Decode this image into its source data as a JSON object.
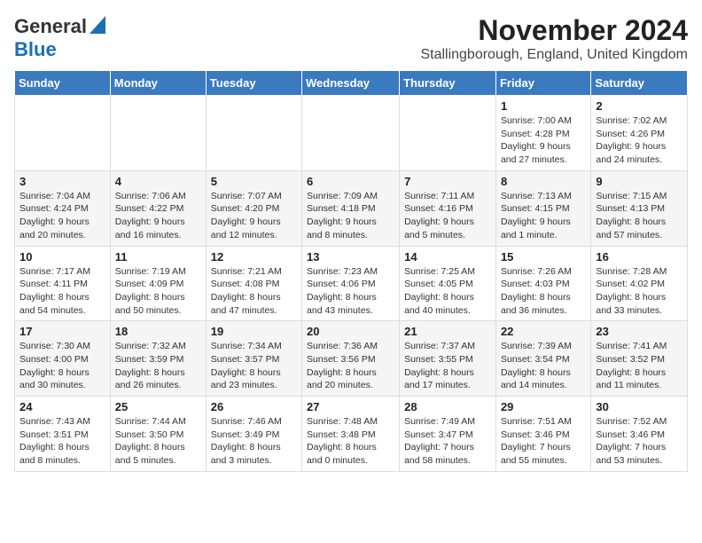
{
  "logo": {
    "line1": "General",
    "line2": "Blue"
  },
  "title": "November 2024",
  "subtitle": "Stallingborough, England, United Kingdom",
  "days_of_week": [
    "Sunday",
    "Monday",
    "Tuesday",
    "Wednesday",
    "Thursday",
    "Friday",
    "Saturday"
  ],
  "weeks": [
    [
      {
        "day": "",
        "info": ""
      },
      {
        "day": "",
        "info": ""
      },
      {
        "day": "",
        "info": ""
      },
      {
        "day": "",
        "info": ""
      },
      {
        "day": "",
        "info": ""
      },
      {
        "day": "1",
        "info": "Sunrise: 7:00 AM\nSunset: 4:28 PM\nDaylight: 9 hours and 27 minutes."
      },
      {
        "day": "2",
        "info": "Sunrise: 7:02 AM\nSunset: 4:26 PM\nDaylight: 9 hours and 24 minutes."
      }
    ],
    [
      {
        "day": "3",
        "info": "Sunrise: 7:04 AM\nSunset: 4:24 PM\nDaylight: 9 hours and 20 minutes."
      },
      {
        "day": "4",
        "info": "Sunrise: 7:06 AM\nSunset: 4:22 PM\nDaylight: 9 hours and 16 minutes."
      },
      {
        "day": "5",
        "info": "Sunrise: 7:07 AM\nSunset: 4:20 PM\nDaylight: 9 hours and 12 minutes."
      },
      {
        "day": "6",
        "info": "Sunrise: 7:09 AM\nSunset: 4:18 PM\nDaylight: 9 hours and 8 minutes."
      },
      {
        "day": "7",
        "info": "Sunrise: 7:11 AM\nSunset: 4:16 PM\nDaylight: 9 hours and 5 minutes."
      },
      {
        "day": "8",
        "info": "Sunrise: 7:13 AM\nSunset: 4:15 PM\nDaylight: 9 hours and 1 minute."
      },
      {
        "day": "9",
        "info": "Sunrise: 7:15 AM\nSunset: 4:13 PM\nDaylight: 8 hours and 57 minutes."
      }
    ],
    [
      {
        "day": "10",
        "info": "Sunrise: 7:17 AM\nSunset: 4:11 PM\nDaylight: 8 hours and 54 minutes."
      },
      {
        "day": "11",
        "info": "Sunrise: 7:19 AM\nSunset: 4:09 PM\nDaylight: 8 hours and 50 minutes."
      },
      {
        "day": "12",
        "info": "Sunrise: 7:21 AM\nSunset: 4:08 PM\nDaylight: 8 hours and 47 minutes."
      },
      {
        "day": "13",
        "info": "Sunrise: 7:23 AM\nSunset: 4:06 PM\nDaylight: 8 hours and 43 minutes."
      },
      {
        "day": "14",
        "info": "Sunrise: 7:25 AM\nSunset: 4:05 PM\nDaylight: 8 hours and 40 minutes."
      },
      {
        "day": "15",
        "info": "Sunrise: 7:26 AM\nSunset: 4:03 PM\nDaylight: 8 hours and 36 minutes."
      },
      {
        "day": "16",
        "info": "Sunrise: 7:28 AM\nSunset: 4:02 PM\nDaylight: 8 hours and 33 minutes."
      }
    ],
    [
      {
        "day": "17",
        "info": "Sunrise: 7:30 AM\nSunset: 4:00 PM\nDaylight: 8 hours and 30 minutes."
      },
      {
        "day": "18",
        "info": "Sunrise: 7:32 AM\nSunset: 3:59 PM\nDaylight: 8 hours and 26 minutes."
      },
      {
        "day": "19",
        "info": "Sunrise: 7:34 AM\nSunset: 3:57 PM\nDaylight: 8 hours and 23 minutes."
      },
      {
        "day": "20",
        "info": "Sunrise: 7:36 AM\nSunset: 3:56 PM\nDaylight: 8 hours and 20 minutes."
      },
      {
        "day": "21",
        "info": "Sunrise: 7:37 AM\nSunset: 3:55 PM\nDaylight: 8 hours and 17 minutes."
      },
      {
        "day": "22",
        "info": "Sunrise: 7:39 AM\nSunset: 3:54 PM\nDaylight: 8 hours and 14 minutes."
      },
      {
        "day": "23",
        "info": "Sunrise: 7:41 AM\nSunset: 3:52 PM\nDaylight: 8 hours and 11 minutes."
      }
    ],
    [
      {
        "day": "24",
        "info": "Sunrise: 7:43 AM\nSunset: 3:51 PM\nDaylight: 8 hours and 8 minutes."
      },
      {
        "day": "25",
        "info": "Sunrise: 7:44 AM\nSunset: 3:50 PM\nDaylight: 8 hours and 5 minutes."
      },
      {
        "day": "26",
        "info": "Sunrise: 7:46 AM\nSunset: 3:49 PM\nDaylight: 8 hours and 3 minutes."
      },
      {
        "day": "27",
        "info": "Sunrise: 7:48 AM\nSunset: 3:48 PM\nDaylight: 8 hours and 0 minutes."
      },
      {
        "day": "28",
        "info": "Sunrise: 7:49 AM\nSunset: 3:47 PM\nDaylight: 7 hours and 58 minutes."
      },
      {
        "day": "29",
        "info": "Sunrise: 7:51 AM\nSunset: 3:46 PM\nDaylight: 7 hours and 55 minutes."
      },
      {
        "day": "30",
        "info": "Sunrise: 7:52 AM\nSunset: 3:46 PM\nDaylight: 7 hours and 53 minutes."
      }
    ]
  ]
}
